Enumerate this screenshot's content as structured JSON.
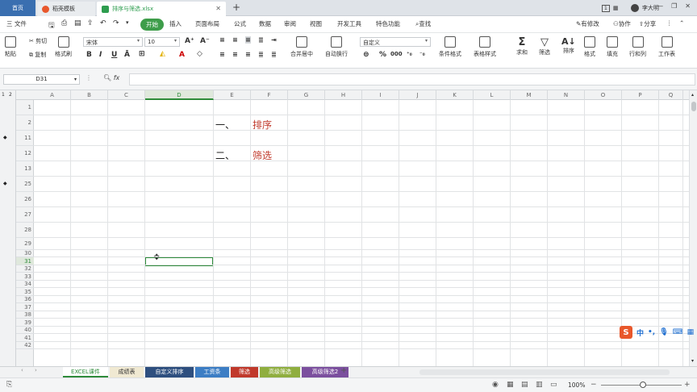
{
  "titlebar": {
    "tabs": [
      {
        "label": "首页"
      },
      {
        "label": "稻壳模板"
      },
      {
        "label": "排序与筛选.xlsx"
      }
    ],
    "user": "李大明",
    "badge": "1"
  },
  "menubar": {
    "file": "三 文件",
    "items": [
      "开始",
      "插入",
      "页面布局",
      "公式",
      "数据",
      "审阅",
      "视图",
      "开发工具",
      "特色功能"
    ],
    "search": "查找",
    "right": [
      "有修改",
      "协作",
      "分享"
    ]
  },
  "ribbon": {
    "paste": "粘贴",
    "cut": "剪切",
    "copy": "复制",
    "format_painter": "格式刷",
    "font_name": "宋体",
    "font_size": "10",
    "merge_center": "合并居中",
    "wrap_text": "自动换行",
    "number_format": "自定义",
    "cond_format": "条件格式",
    "table_style": "表格样式",
    "sum": "求和",
    "filter": "筛选",
    "sort": "排序",
    "format": "格式",
    "fill": "填充",
    "row_col": "行和列",
    "worksheet": "工作表"
  },
  "formulabar": {
    "cell_ref": "D31",
    "fx": "fx",
    "value": ""
  },
  "grid": {
    "outline_levels": [
      "1",
      "2"
    ],
    "columns": [
      "A",
      "B",
      "C",
      "D",
      "E",
      "F",
      "G",
      "H",
      "I",
      "J",
      "K",
      "L",
      "M",
      "N",
      "O",
      "P",
      "Q"
    ],
    "rows": [
      "1",
      "2",
      "11",
      "12",
      "13",
      "25",
      "26",
      "27",
      "28",
      "29",
      "30",
      "31",
      "32",
      "33",
      "34",
      "35",
      "36",
      "37",
      "38",
      "39",
      "40",
      "41",
      "42"
    ],
    "cells": [
      {
        "ref": "E2",
        "text": "一、"
      },
      {
        "ref": "F2",
        "text": "排序"
      },
      {
        "ref": "E12",
        "text": "二、"
      },
      {
        "ref": "F12",
        "text": "筛选"
      }
    ],
    "selected": "D31",
    "accent_color": "#c0392b"
  },
  "sheets": [
    {
      "label": "EXCEL课件",
      "color": "#ffffff",
      "text": "#2e8b3a"
    },
    {
      "label": "成绩表",
      "color": "#f0e9d2",
      "text": "#333333"
    },
    {
      "label": "自定义排序",
      "color": "#2e4f7f",
      "text": "#ffffff"
    },
    {
      "label": "工资条",
      "color": "#3c7dc4",
      "text": "#ffffff"
    },
    {
      "label": "筛选",
      "color": "#c0392b",
      "text": "#ffffff"
    },
    {
      "label": "高级筛选",
      "color": "#8fae3f",
      "text": "#ffffff"
    },
    {
      "label": "高级筛选2",
      "color": "#7b4f9e",
      "text": "#ffffff"
    }
  ],
  "statusbar": {
    "zoom": "100%"
  },
  "ime": {
    "label": "中"
  }
}
